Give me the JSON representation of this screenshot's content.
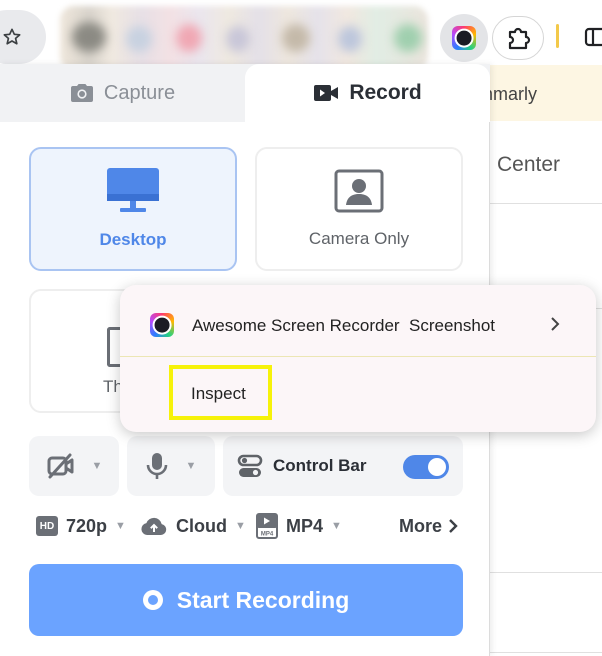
{
  "colors": {
    "accent": "#4f87e8",
    "start_button": "#6ba3ff",
    "highlight_box": "#f6f20a",
    "selected_card_bg": "#eef4fd",
    "selected_card_border": "#a9c4f2"
  },
  "toolbar": {
    "icons": [
      "star-icon",
      "screen-recorder-extension-icon",
      "puzzle-extensions-icon",
      "side-panel-icon"
    ]
  },
  "background_page": {
    "partial_text_1": "mmarly",
    "partial_text_2": "Center"
  },
  "tabs": [
    {
      "label": "Capture",
      "icon": "camera-icon",
      "selected": false
    },
    {
      "label": "Record",
      "icon": "video-camera-icon",
      "selected": true
    }
  ],
  "modes": {
    "desktop": {
      "label": "Desktop",
      "icon": "monitor-icon",
      "selected": true
    },
    "camera_only": {
      "label": "Camera Only",
      "icon": "portrait-icon",
      "selected": false
    },
    "third": {
      "label": "Th",
      "selected": false
    }
  },
  "controls": {
    "camera": {
      "icon": "camera-off-icon"
    },
    "mic": {
      "icon": "microphone-icon"
    },
    "control_bar": {
      "label": "Control Bar",
      "icon": "control-bar-icon",
      "enabled": true
    }
  },
  "options": {
    "resolution": {
      "label": "720p",
      "badge": "HD"
    },
    "storage": {
      "label": "Cloud",
      "icon": "cloud-upload-icon"
    },
    "format": {
      "label": "MP4",
      "icon_text": "MP4"
    },
    "more": {
      "label": "More"
    }
  },
  "start_button": {
    "label": "Start Recording"
  },
  "context_menu": {
    "items": [
      {
        "label": "Awesome Screen Recorder  Screenshot",
        "icon": "screen-recorder-icon",
        "submenu": true
      },
      {
        "label": "Inspect",
        "highlighted": true
      }
    ]
  }
}
